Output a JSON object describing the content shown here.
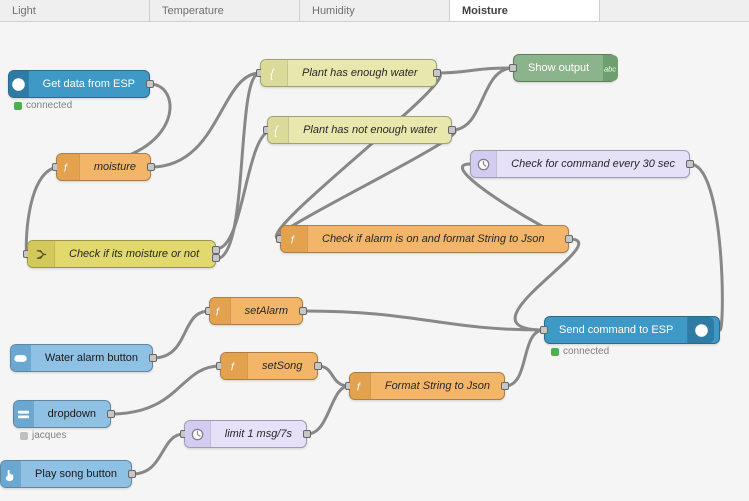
{
  "tabs": [
    "Light",
    "Temperature",
    "Humidity",
    "Moisture"
  ],
  "active_tab": 3,
  "nodes": {
    "get_data": {
      "label": "Get data from ESP",
      "status": "connected",
      "status_color": "#4caf50"
    },
    "moisture": {
      "label": "moisture"
    },
    "check_moist": {
      "label": "Check if its moisture or not"
    },
    "enough": {
      "label": "Plant has enough water"
    },
    "not_enough": {
      "label": "Plant has not enough water"
    },
    "show_output": {
      "label": "Show output"
    },
    "check_cmd": {
      "label": "Check for command every 30 sec"
    },
    "check_alarm": {
      "label": "Check if alarm is on and format String to Json"
    },
    "water_btn": {
      "label": "Water alarm button"
    },
    "set_alarm": {
      "label": "setAlarm"
    },
    "set_song": {
      "label": "setSong"
    },
    "dropdown": {
      "label": "dropdown",
      "status": "jacques",
      "status_color": "#bfbfbf"
    },
    "limit": {
      "label": "limit 1 msg/7s"
    },
    "format_json": {
      "label": "Format String to Json"
    },
    "play_btn": {
      "label": "Play song button"
    },
    "send_cmd": {
      "label": "Send command to ESP",
      "status": "connected",
      "status_color": "#4caf50"
    }
  }
}
